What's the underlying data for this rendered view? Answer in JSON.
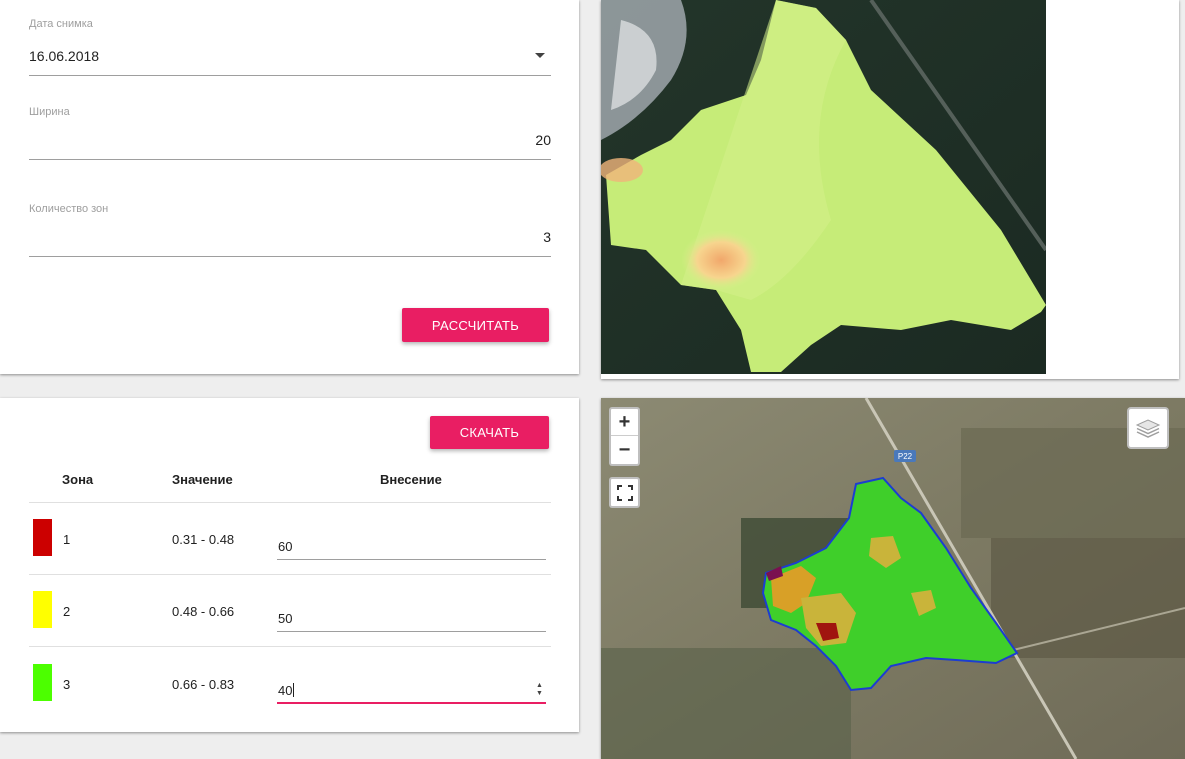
{
  "settings": {
    "date_label": "Дата снимка",
    "date_value": "16.06.2018",
    "width_label": "Ширина",
    "width_value": "20",
    "zones_label": "Количество зон",
    "zones_value": "3",
    "calc_button": "РАССЧИТАТЬ"
  },
  "zones": {
    "download_button": "СКАЧАТЬ",
    "headers": {
      "zone": "Зона",
      "value": "Значение",
      "rate": "Внесение"
    },
    "rows": [
      {
        "zone": "1",
        "range": "0.31 - 0.48",
        "rate": "60",
        "color": "#cc0000"
      },
      {
        "zone": "2",
        "range": "0.48 - 0.66",
        "rate": "50",
        "color": "#ffff00"
      },
      {
        "zone": "3",
        "range": "0.66 - 0.83",
        "rate": "40",
        "color": "#4cff00"
      }
    ]
  },
  "map": {
    "zoom_in": "+",
    "zoom_out": "−",
    "road_label": "P22",
    "icons": [
      "zoom-in-icon",
      "zoom-out-icon",
      "fullscreen-icon",
      "layers-icon"
    ]
  },
  "colors": {
    "accent": "#e91e63",
    "ndvi_high": "#c7ef7a",
    "ndvi_low": "#f4b37a"
  }
}
